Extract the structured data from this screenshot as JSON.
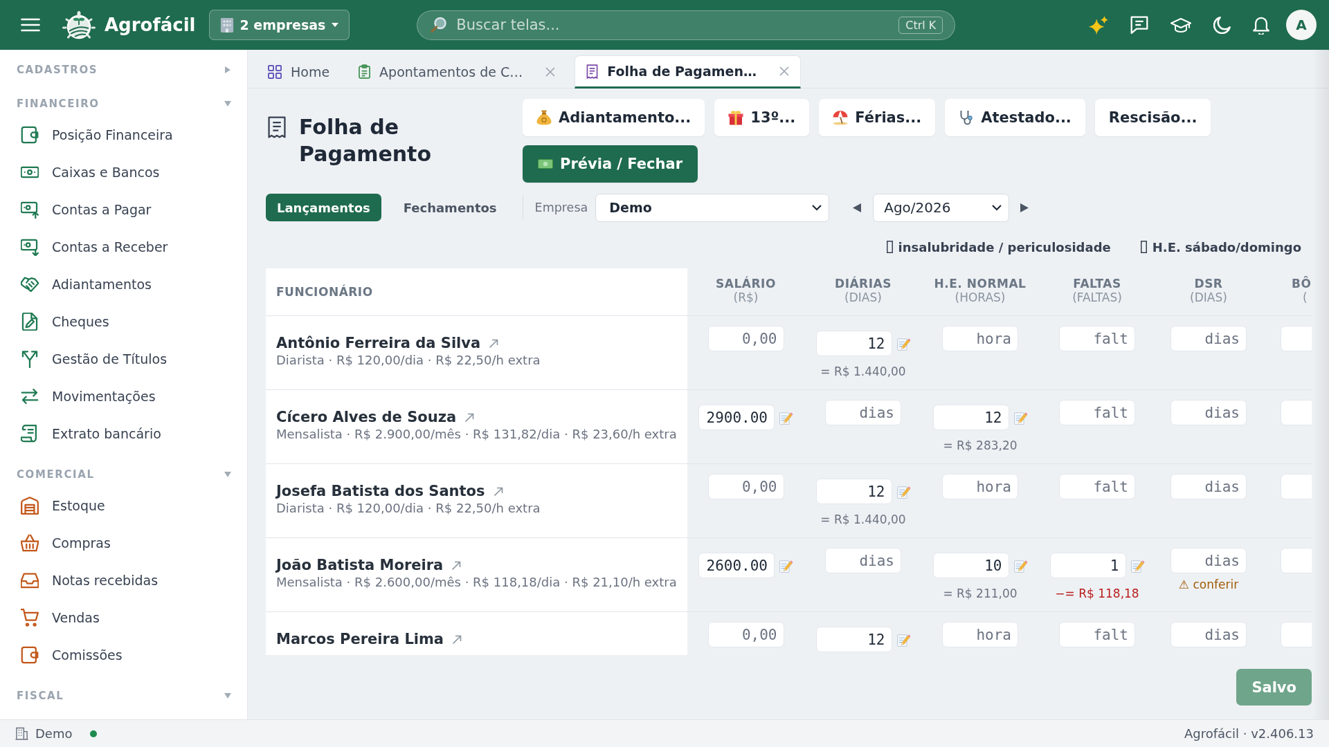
{
  "topbar": {
    "brand": "Agrofácil",
    "company_switch": "2 empresas",
    "search": {
      "placeholder": "Buscar telas...",
      "shortcut": "Ctrl K"
    },
    "avatar": "A"
  },
  "sidebar": {
    "sections": [
      {
        "title": "CADASTROS",
        "expanded": false
      },
      {
        "title": "FINANCEIRO",
        "expanded": true,
        "items": [
          {
            "label": "Posição Financeira",
            "selected": false
          },
          {
            "label": "Caixas e Bancos",
            "selected": false
          },
          {
            "label": "Contas a Pagar",
            "selected": false
          },
          {
            "label": "Contas a Receber",
            "selected": false
          },
          {
            "label": "Adiantamentos",
            "selected": false
          },
          {
            "label": "Cheques",
            "selected": false
          },
          {
            "label": "Gestão de Títulos",
            "selected": false
          },
          {
            "label": "Movimentações",
            "selected": false
          },
          {
            "label": "Extrato bancário",
            "selected": false
          }
        ]
      },
      {
        "title": "COMERCIAL",
        "expanded": true,
        "items": [
          {
            "label": "Estoque",
            "selected": false
          },
          {
            "label": "Compras",
            "selected": false
          },
          {
            "label": "Notas recebidas",
            "selected": false
          },
          {
            "label": "Vendas",
            "selected": false
          },
          {
            "label": "Comissões",
            "selected": false
          }
        ]
      },
      {
        "title": "FISCAL",
        "expanded": true
      }
    ]
  },
  "tabs": [
    {
      "label": "Home",
      "kind": "home",
      "selected": false,
      "closable": false
    },
    {
      "label": "Apontamentos de C…",
      "kind": "timesheet",
      "selected": false,
      "closable": true
    },
    {
      "label": "Folha de Pagamen…",
      "kind": "payroll",
      "selected": true,
      "closable": true
    }
  ],
  "page": {
    "title": "Folha de Pagamento",
    "actions": [
      {
        "label": "Adiantamento...",
        "kind": "advance",
        "primary": false
      },
      {
        "label": "13º...",
        "kind": "thirteenth",
        "primary": false
      },
      {
        "label": "Férias...",
        "kind": "vacation",
        "primary": false
      },
      {
        "label": "Atestado...",
        "kind": "sick_note",
        "primary": false
      },
      {
        "label": "Rescisão...",
        "kind": "termination",
        "primary": false
      },
      {
        "label": "Prévia / Fechar",
        "kind": "closing",
        "primary": true
      }
    ]
  },
  "toolbar": {
    "views": [
      {
        "label": "Lançamentos",
        "selected": true
      },
      {
        "label": "Fechamentos",
        "selected": false
      }
    ],
    "company": {
      "label": "Empresa",
      "value": "Demo"
    },
    "period": "Ago/2026"
  },
  "options": [
    "insalubridade / periculosidade",
    "H.E. sábado/domingo"
  ],
  "table": {
    "columns": [
      {
        "title": "FUNCIONÁRIO"
      },
      {
        "title": "SALÁRIO",
        "unit": "(R$)"
      },
      {
        "title": "DIÁRIAS",
        "unit": "(DIAS)"
      },
      {
        "title": "H.E. NORMAL",
        "unit": "(HORAS)"
      },
      {
        "title": "FALTAS",
        "unit": "(FALTAS)"
      },
      {
        "title": "DSR",
        "unit": "(DIAS)"
      },
      {
        "title": "BÔ",
        "unit": "("
      }
    ],
    "rows": [
      {
        "cells": [
          {
            "kind": "employee",
            "name": "Antônio Ferreira da Silva",
            "detail": "Diarista · R$ 120,00/dia · R$ 22,50/h extra"
          },
          {
            "kind": "field",
            "placeholder": "0,00"
          },
          {
            "kind": "field",
            "value": "12",
            "note": {
              "text": "= R$ 1.440,00",
              "kind": "total"
            }
          },
          {
            "kind": "field",
            "placeholder": "hora"
          },
          {
            "kind": "field",
            "placeholder": "falt"
          },
          {
            "kind": "field",
            "placeholder": "dias"
          },
          {
            "kind": "field"
          }
        ]
      },
      {
        "cells": [
          {
            "kind": "employee",
            "name": "Cícero Alves de Souza",
            "detail": "Mensalista · R$ 2.900,00/mês · R$ 131,82/dia · R$ 23,60/h extra"
          },
          {
            "kind": "field",
            "value": "2900.00"
          },
          {
            "kind": "field",
            "placeholder": "dias"
          },
          {
            "kind": "field",
            "value": "12",
            "note": {
              "text": "= R$ 283,20",
              "kind": "total"
            }
          },
          {
            "kind": "field",
            "placeholder": "falt"
          },
          {
            "kind": "field",
            "placeholder": "dias"
          },
          {
            "kind": "field"
          }
        ]
      },
      {
        "cells": [
          {
            "kind": "employee",
            "name": "Josefa Batista dos Santos",
            "detail": "Diarista · R$ 120,00/dia · R$ 22,50/h extra"
          },
          {
            "kind": "field",
            "placeholder": "0,00"
          },
          {
            "kind": "field",
            "value": "12",
            "note": {
              "text": "= R$ 1.440,00",
              "kind": "total"
            }
          },
          {
            "kind": "field",
            "placeholder": "hora"
          },
          {
            "kind": "field",
            "placeholder": "falt"
          },
          {
            "kind": "field",
            "placeholder": "dias"
          },
          {
            "kind": "field"
          }
        ]
      },
      {
        "cells": [
          {
            "kind": "employee",
            "name": "João Batista Moreira",
            "detail": "Mensalista · R$ 2.600,00/mês · R$ 118,18/dia · R$ 21,10/h extra"
          },
          {
            "kind": "field",
            "value": "2600.00"
          },
          {
            "kind": "field",
            "placeholder": "dias"
          },
          {
            "kind": "field",
            "value": "10",
            "note": {
              "text": "= R$ 211,00",
              "kind": "total"
            }
          },
          {
            "kind": "field",
            "value": "1",
            "note": {
              "text": "−= R$ 118,18",
              "kind": "deduction"
            }
          },
          {
            "kind": "field",
            "placeholder": "dias",
            "note": {
              "text": "⚠ conferir",
              "kind": "warning"
            }
          },
          {
            "kind": "field"
          }
        ]
      },
      {
        "cells": [
          {
            "kind": "employee",
            "name": "Marcos Pereira Lima"
          },
          {
            "kind": "field",
            "placeholder": "0,00"
          },
          {
            "kind": "field",
            "value": "12"
          },
          {
            "kind": "field",
            "placeholder": "hora"
          },
          {
            "kind": "field",
            "placeholder": "falt"
          },
          {
            "kind": "field",
            "placeholder": "dias"
          },
          {
            "kind": "field"
          }
        ]
      }
    ]
  },
  "save_button": {
    "label": "Salvo",
    "disabled": true
  },
  "status_bar": {
    "company": "Demo",
    "connected": true,
    "version": "Agrofácil · v2.406.13"
  }
}
